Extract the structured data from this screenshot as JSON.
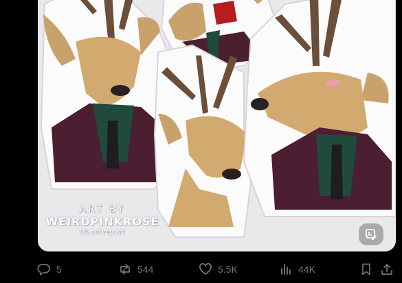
{
  "media": {
    "watermark": {
      "line1": "ART BY",
      "line2": "WEIRDPINKROSE",
      "line3": "DO not repost!"
    }
  },
  "actions": {
    "replies": "5",
    "reposts": "544",
    "likes": "5.5K",
    "views": "44K"
  },
  "colors": {
    "background": "#000000",
    "icon": "#71767b",
    "panel": "#e9e8ea"
  }
}
